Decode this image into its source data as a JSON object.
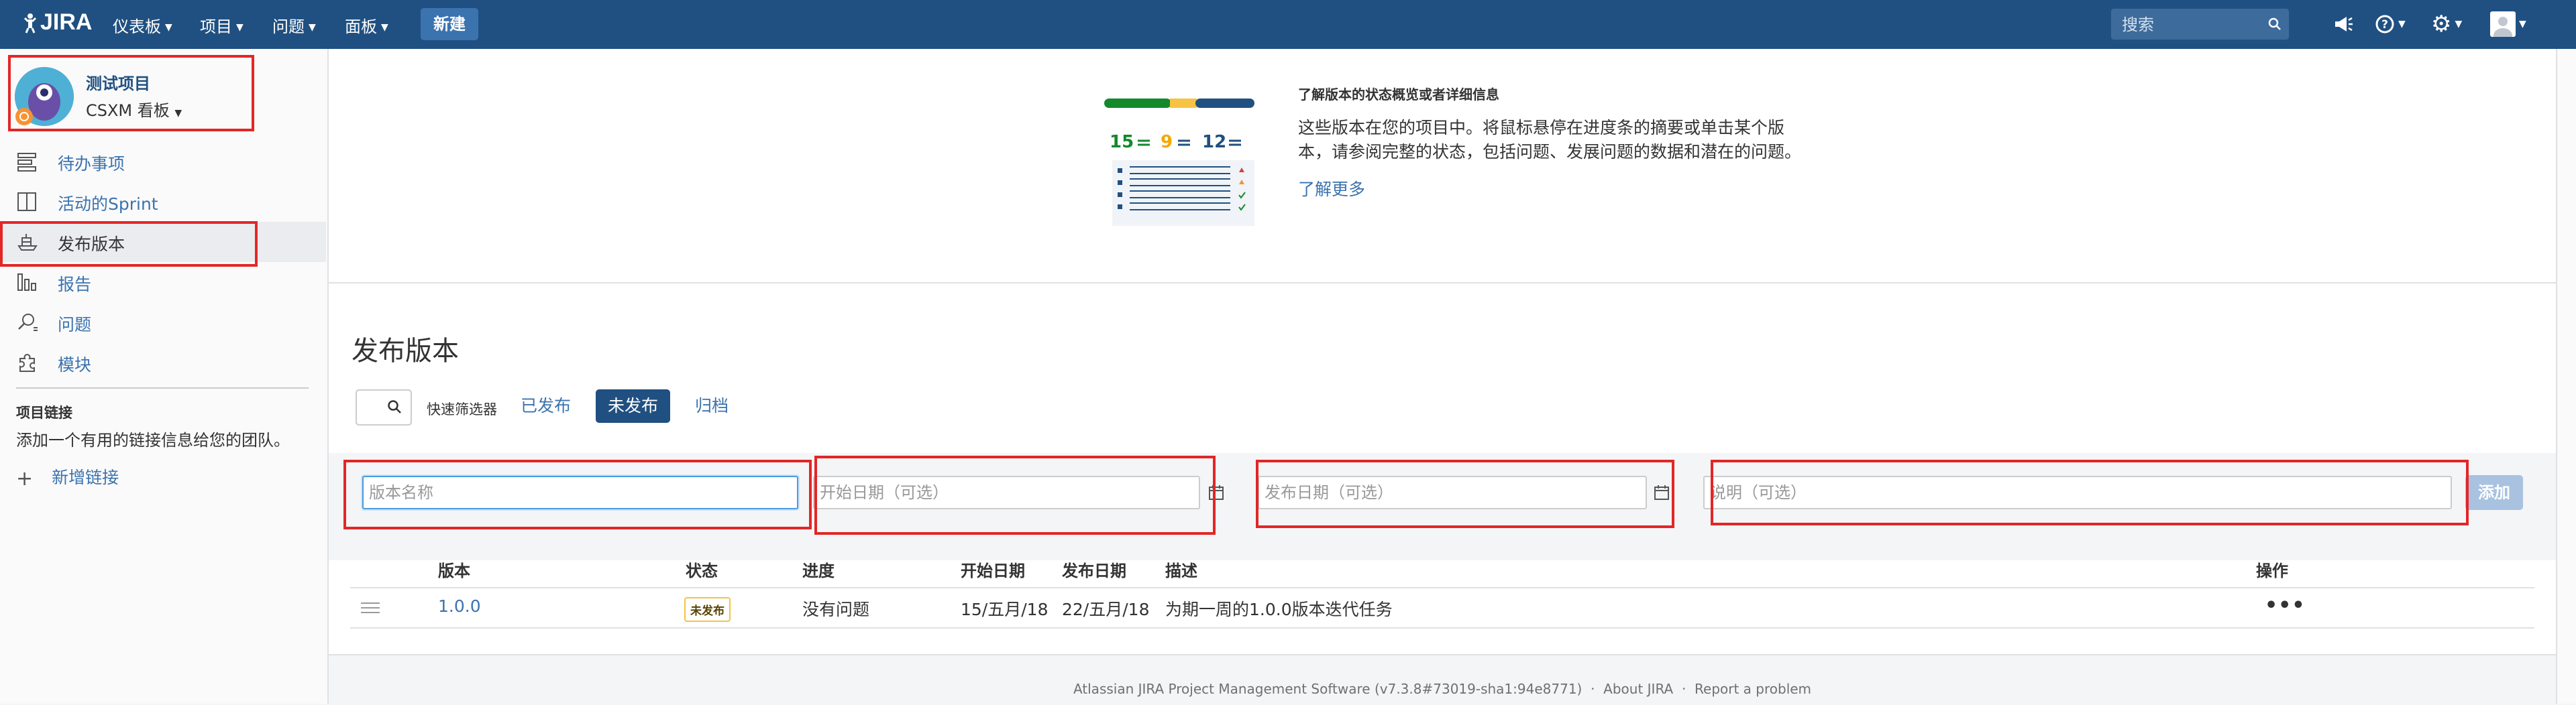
{
  "topbar": {
    "logo": "JIRA",
    "nav": [
      "仪表板",
      "项目",
      "问题",
      "面板"
    ],
    "create_label": "新建",
    "search_placeholder": "搜索",
    "colors": {
      "bar": "#205081",
      "create": "#3b73af"
    }
  },
  "sidebar": {
    "project_name": "测试项目",
    "board_name": "CSXM 看板",
    "items": [
      {
        "label": "待办事项",
        "icon": "backlog-icon"
      },
      {
        "label": "活动的Sprint",
        "icon": "board-icon"
      },
      {
        "label": "发布版本",
        "icon": "ship-icon"
      },
      {
        "label": "报告",
        "icon": "chart-icon"
      },
      {
        "label": "问题",
        "icon": "issues-search-icon"
      },
      {
        "label": "模块",
        "icon": "puzzle-icon"
      }
    ],
    "project_links_title": "项目链接",
    "project_links_desc": "添加一个有用的链接信息给您的团队。",
    "add_link_label": "新增链接"
  },
  "info": {
    "title": "了解版本的状态概览或者详细信息",
    "text": "这些版本在您的项目中。将鼠标悬停在进度条的摘要或单击某个版本，请参阅完整的状态，包括问题、发展问题的数据和潜在的问题。",
    "link": "了解更多",
    "illustration_counts": [
      "15",
      "9",
      "12"
    ]
  },
  "page": {
    "title": "发布版本",
    "quick_filter_label": "快速筛选器",
    "filters": [
      "已发布",
      "未发布",
      "归档"
    ],
    "active_filter": "未发布"
  },
  "form": {
    "name_placeholder": "版本名称",
    "start_placeholder": "开始日期（可选）",
    "release_placeholder": "发布日期（可选）",
    "desc_placeholder": "说明（可选）",
    "add_label": "添加"
  },
  "table": {
    "headers": [
      "版本",
      "状态",
      "进度",
      "开始日期",
      "发布日期",
      "描述",
      "操作"
    ],
    "rows": [
      {
        "version": "1.0.0",
        "status": "未发布",
        "progress": "没有问题",
        "start": "15/五月/18",
        "release": "22/五月/18",
        "description": "为期一周的1.0.0版本迭代任务",
        "actions": "•••"
      }
    ]
  },
  "footer": {
    "software": "Atlassian JIRA Project Management Software (v7.3.8#73019-sha1:94e8771)",
    "about": "About JIRA",
    "report": "Report a problem",
    "separator": "·"
  }
}
